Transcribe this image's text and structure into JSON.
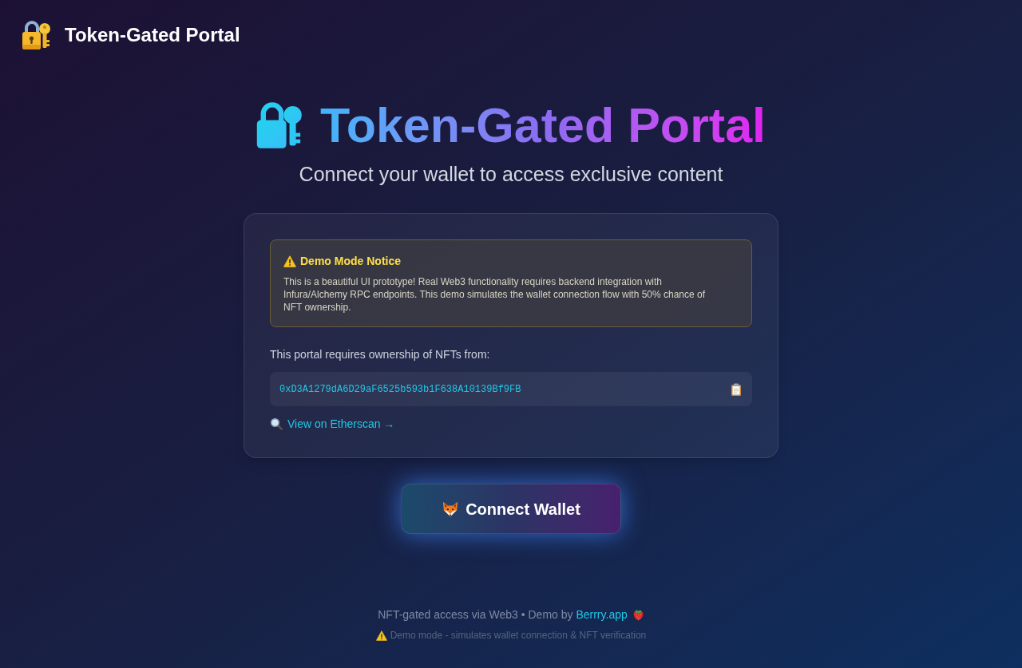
{
  "header": {
    "title": "Token-Gated Portal"
  },
  "hero": {
    "title": "Token-Gated Portal",
    "subtitle": "Connect your wallet to access exclusive content"
  },
  "notice": {
    "title": "Demo Mode Notice",
    "text": "This is a beautiful UI prototype! Real Web3 functionality requires backend integration with Infura/Alchemy RPC endpoints. This demo simulates the wallet connection flow with 50% chance of NFT ownership."
  },
  "requirement": {
    "label": "This portal requires ownership of NFTs from:",
    "contract_address": "0xD3A1279dA6D29aF6525b593b1F638A10139Bf9FB",
    "link": "View on Etherscan →"
  },
  "connect_button": {
    "label": "Connect Wallet"
  },
  "footer": {
    "text": "NFT-gated access via Web3 • Demo by",
    "link": "Berrry.app",
    "note": "Demo mode - simulates wallet connection & NFT verification"
  }
}
